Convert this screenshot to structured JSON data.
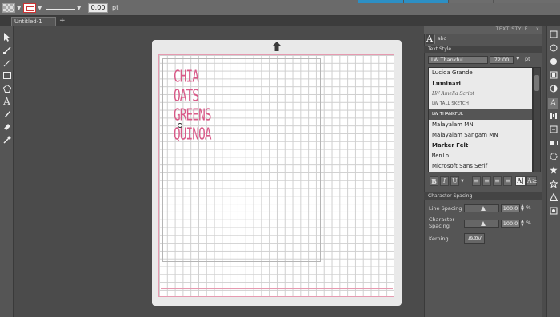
{
  "toolbar": {
    "line_weight": "0.00",
    "weight_unit": "pt"
  },
  "document": {
    "tab_title": "Untitled-1",
    "add_tab_symbol": "+"
  },
  "mat": {
    "text_lines": [
      "CHIA",
      "OATS",
      "GREENS",
      "QUINOA"
    ],
    "text_color": "#d85a88"
  },
  "panel": {
    "title": "TEXT STYLE",
    "close_symbol": "x",
    "text_style_icon_a": "A|",
    "text_style_icon_b": "abc",
    "text_style_header": "Text Style",
    "font_name": "LW Thankful",
    "font_size": "72.00",
    "font_size_unit": "pt",
    "fonts": [
      {
        "label": "Lucida Grande",
        "selected": false
      },
      {
        "label": "Luminari",
        "selected": false
      },
      {
        "label": "LW Amelia Script",
        "selected": false
      },
      {
        "label": "LW TALL SKETCH",
        "selected": false
      },
      {
        "label": "LW THANKFUL",
        "selected": true
      },
      {
        "label": "Malayalam MN",
        "selected": false
      },
      {
        "label": "Malayalam Sangam MN",
        "selected": false
      },
      {
        "label": "Marker Felt",
        "selected": false
      },
      {
        "label": "Menlo",
        "selected": false
      },
      {
        "label": "Microsoft Sans Serif",
        "selected": false
      }
    ],
    "style_buttons": {
      "bold": "B",
      "italic": "I",
      "underline": "U",
      "align_left": "≡",
      "align_center": "≡",
      "align_right": "≡",
      "justify": "≡",
      "text_frame": "A|",
      "text_path": "A≥"
    },
    "character_spacing": {
      "header": "Character Spacing",
      "line_spacing_label": "Line Spacing",
      "line_spacing_value": "100.0",
      "char_spacing_label": "Character Spacing",
      "char_spacing_value": "100.0",
      "percent": "%",
      "step_up": "▲",
      "step_down": "▼",
      "kerning_label": "Kerning",
      "kerning_value": "AVAV"
    }
  }
}
